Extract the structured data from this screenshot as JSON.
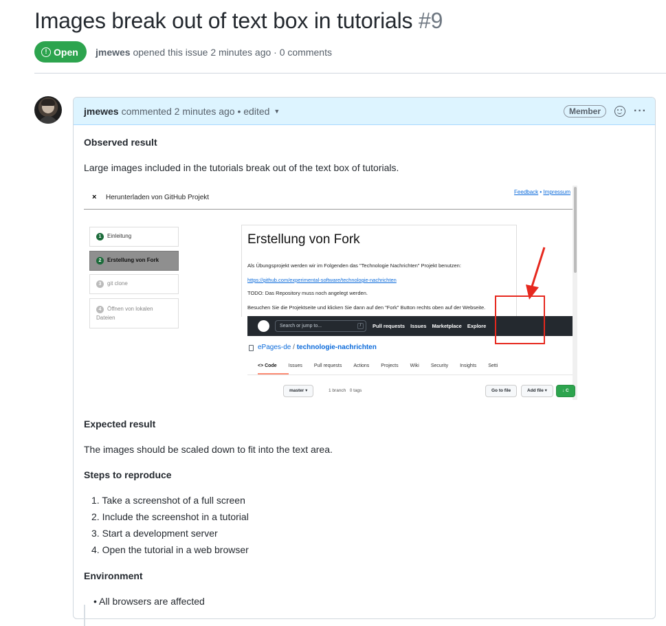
{
  "issue": {
    "title": "Images break out of text box in tutorials",
    "number": "#9",
    "state": "Open",
    "author": "jmewes",
    "meta": "opened this issue 2 minutes ago · 0 comments"
  },
  "comment": {
    "author": "jmewes",
    "action": "commented",
    "time": "2 minutes ago",
    "edited": "• edited",
    "badge": "Member",
    "observed_heading": "Observed result",
    "observed_text": "Large images included in the tutorials break out of the text box of tutorials.",
    "expected_heading": "Expected result",
    "expected_text": "The images should be scaled down to fit into the text area.",
    "steps_heading": "Steps to reproduce",
    "steps": [
      "1. Take a screenshot of a full screen",
      "2. Include the screenshot in a tutorial",
      "3. Start a development server",
      "4. Open the tutorial in a web browser"
    ],
    "env_heading": "Environment",
    "env_items": [
      "• All browsers are affected"
    ]
  },
  "screenshot": {
    "close": "×",
    "page_title": "Herunterladen von GitHub Projekt",
    "link_feedback": "Feedback",
    "link_sep": " • ",
    "link_impressum": "Impressum",
    "steps": [
      {
        "n": "1",
        "label": "Einleitung"
      },
      {
        "n": "2",
        "label": "Erstellung von Fork"
      },
      {
        "n": "3",
        "label": "git clone"
      },
      {
        "n": "4",
        "label": "Öffnen von lokalen Dateien"
      }
    ],
    "heading": "Erstellung von Fork",
    "line1": "Als Übungsprojekt werden wir im Folgenden das \"Technologie Nachrichten\" Projekt benutzen:",
    "link": "https://github.com/experimental-software/technologie-nachrichten",
    "line2": "TODO: Das Repository muss noch angelegt werden.",
    "line3": "Besuchen Sie die Projektseite und klicken Sie dann auf den \"Fork\" Button rechts oben auf der Webseite.",
    "gh_search": "Search or jump to...",
    "gh_slash": "/",
    "gh_nav": [
      "Pull requests",
      "Issues",
      "Marketplace",
      "Explore"
    ],
    "repo_owner": "ePages-de",
    "repo_sep": " / ",
    "repo_name": "technologie-nachrichten",
    "tabs": [
      "<> Code",
      "Issues",
      "Pull requests",
      "Actions",
      "Projects",
      "Wiki",
      "Security",
      "Insights",
      "Setti"
    ],
    "branch_btn": "master ▾",
    "branch_count": "1 branch",
    "tags_count": "0 tags",
    "goto_file": "Go to file",
    "add_file": "Add file ▾",
    "code_btn": "↓ C"
  }
}
